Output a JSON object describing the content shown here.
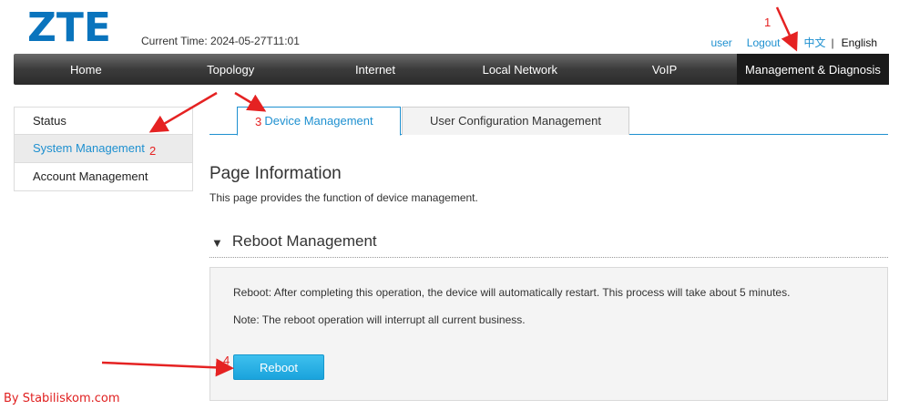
{
  "brand": {
    "logo_text": "ZTE",
    "color": "#0a74bd"
  },
  "header": {
    "current_time": "Current Time: 2024-05-27T11:01",
    "links": {
      "user": "user",
      "logout": "Logout",
      "chinese": "中文",
      "separator": "|",
      "english": "English"
    }
  },
  "nav": {
    "items": [
      {
        "label": "Home"
      },
      {
        "label": "Topology"
      },
      {
        "label": "Internet"
      },
      {
        "label": "Local Network"
      },
      {
        "label": "VoIP"
      },
      {
        "label": "Management & Diagnosis",
        "active": true
      }
    ]
  },
  "sidebar": {
    "items": [
      {
        "label": "Status"
      },
      {
        "label": "System Management",
        "active": true
      },
      {
        "label": "Account Management"
      }
    ]
  },
  "tabs": [
    {
      "label": "Device Management",
      "active": true
    },
    {
      "label": "User Configuration Management"
    }
  ],
  "page": {
    "title": "Page Information",
    "description": "This page provides the function of device management."
  },
  "section": {
    "title": "Reboot Management",
    "text1": "Reboot: After completing this operation, the device will automatically restart. This process will take about 5 minutes.",
    "text2": "Note: The reboot operation will interrupt all current business.",
    "button_label": "Reboot"
  },
  "annotations": {
    "markers": [
      "1",
      "2",
      "3",
      "4"
    ],
    "color": "#e52222"
  },
  "watermark": "By Stabiliskom.com",
  "colors": {
    "accent": "#1e90d0",
    "navbar": "#3b3b3b",
    "button": "#1aa3dc"
  }
}
